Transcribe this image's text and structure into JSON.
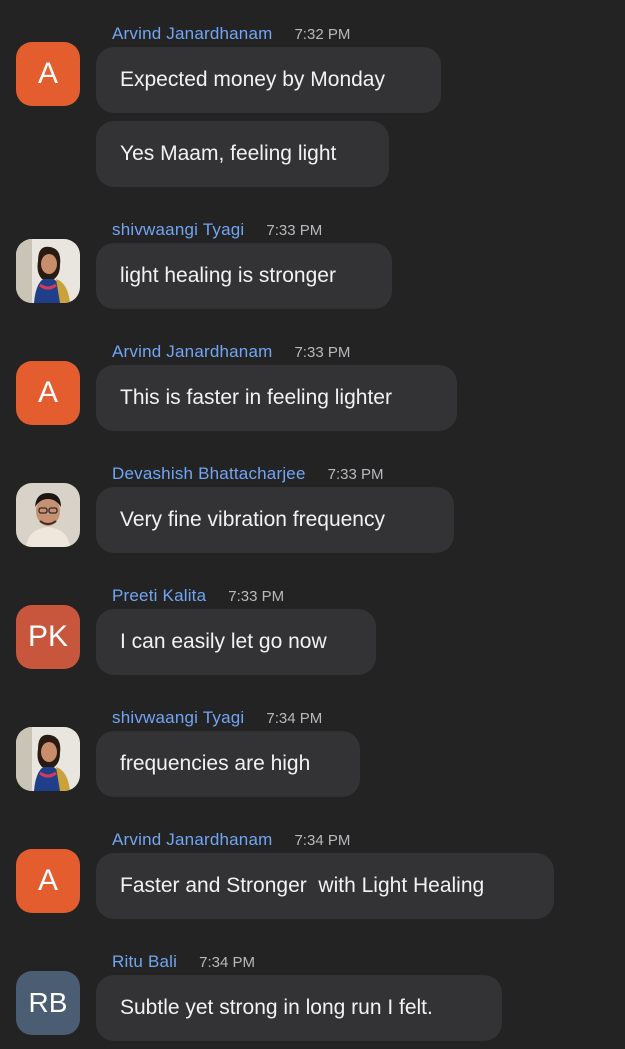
{
  "messages": [
    {
      "sender": "Arvind Janardhanam",
      "time": "7:32 PM",
      "avatar": "A",
      "text": "Expected money by Monday"
    },
    {
      "text": "Yes Maam, feeling light"
    },
    {
      "sender": "shivwaangi Tyagi",
      "time": "7:33 PM",
      "avatar_icon": "woman-profile-photo",
      "text": "light healing is stronger"
    },
    {
      "sender": "Arvind Janardhanam",
      "time": "7:33 PM",
      "avatar": "A",
      "text": "This is faster in feeling lighter"
    },
    {
      "sender": "Devashish Bhattacharjee",
      "time": "7:33 PM",
      "avatar_icon": "man-profile-photo",
      "text": "Very fine vibration frequency"
    },
    {
      "sender": "Preeti Kalita",
      "time": "7:33 PM",
      "avatar": "PK",
      "text": "I can easily let go now"
    },
    {
      "sender": "shivwaangi Tyagi",
      "time": "7:34 PM",
      "avatar_icon": "woman-profile-photo",
      "text": "frequencies are high"
    },
    {
      "sender": "Arvind Janardhanam",
      "time": "7:34 PM",
      "avatar": "A",
      "text": "Faster and Stronger  with Light Healing"
    },
    {
      "sender": "Ritu Bali",
      "time": "7:34 PM",
      "avatar": "RB",
      "text": "Subtle yet strong in long run I felt."
    }
  ],
  "colors": {
    "background": "#232324",
    "bubble": "#333335",
    "sender_name": "#72a5f2",
    "timestamp": "#b9b9bd",
    "avatar_arvind": "#e35d2f",
    "avatar_preeti": "#c7563d",
    "avatar_ritu": "#4b5d72"
  }
}
